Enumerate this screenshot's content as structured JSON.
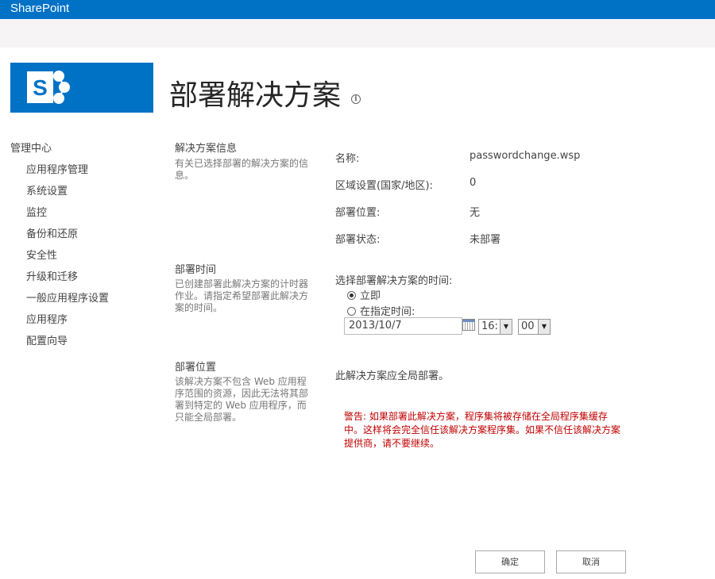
{
  "brand": {
    "name": "SharePoint"
  },
  "page": {
    "title": "部署解决方案",
    "info_icon": "info-icon"
  },
  "nav": {
    "items": [
      {
        "label": "管理中心"
      },
      {
        "label": "应用程序管理"
      },
      {
        "label": "系统设置"
      },
      {
        "label": "监控"
      },
      {
        "label": "备份和还原"
      },
      {
        "label": "安全性"
      },
      {
        "label": "升级和迁移"
      },
      {
        "label": "一般应用程序设置"
      },
      {
        "label": "应用程序"
      },
      {
        "label": "配置向导"
      }
    ]
  },
  "solution_info": {
    "title": "解决方案信息",
    "description": "有关已选择部署的解决方案的信息。",
    "fields": [
      {
        "label": "名称:",
        "value": "passwordchange.wsp"
      },
      {
        "label": "区域设置(国家/地区):",
        "value": "0"
      },
      {
        "label": "部署位置:",
        "value": "无"
      },
      {
        "label": "部署状态:",
        "value": "未部署"
      }
    ]
  },
  "deploy_time": {
    "title": "部署时间",
    "description": "已创建部署此解决方案的计时器作业。请指定希望部署此解决方案的时间。",
    "prompt": "选择部署解决方案的时间:",
    "options": [
      {
        "label": "立即",
        "checked": true
      },
      {
        "label": "在指定时间:",
        "checked": false
      }
    ],
    "date_value": "2013/10/7",
    "hour_value": "16:",
    "minute_value": "00"
  },
  "deploy_location": {
    "title": "部署位置",
    "description": "该解决方案不包含 Web 应用程序范围的资源，因此无法将其部署到特定的 Web 应用程序，而只能全局部署。",
    "note": "此解决方案应全局部署。",
    "warning": "警告: 如果部署此解决方案，程序集将被存储在全局程序集缓存中。这样将会完全信任该解决方案程序集。如果不信任该解决方案提供商，请不要继续。"
  },
  "buttons": {
    "ok": "确定",
    "cancel": "取消"
  },
  "colors": {
    "brand_blue": "#0072c6",
    "warning_red": "#c00000"
  }
}
